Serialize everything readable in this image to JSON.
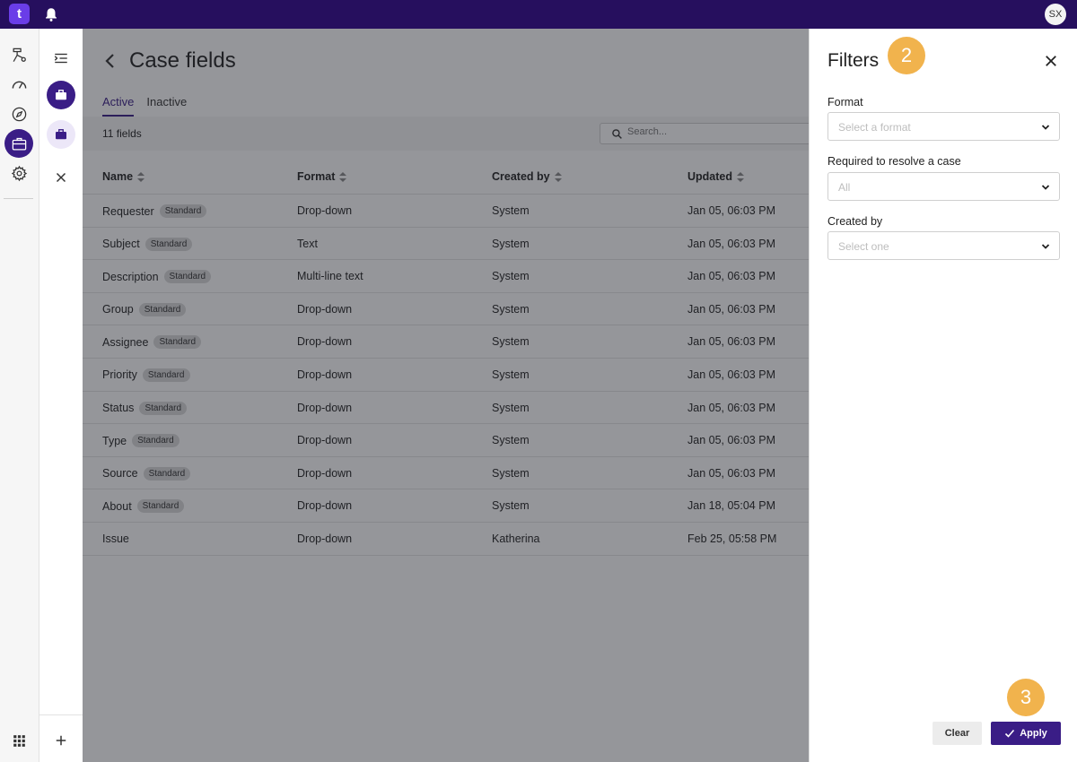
{
  "app": {
    "logo_text": "t",
    "avatar_initials": "SX"
  },
  "page": {
    "title": "Case fields",
    "tabs": [
      {
        "label": "Active",
        "active": true
      },
      {
        "label": "Inactive",
        "active": false
      }
    ],
    "count_label": "11 fields",
    "search_placeholder": "Search..."
  },
  "table": {
    "headers": [
      "Name",
      "Format",
      "Created by",
      "Updated"
    ],
    "rows": [
      {
        "name": "Requester",
        "badge": "Standard",
        "format": "Drop-down",
        "created_by": "System",
        "updated": "Jan 05, 06:03 PM"
      },
      {
        "name": "Subject",
        "badge": "Standard",
        "format": "Text",
        "created_by": "System",
        "updated": "Jan 05, 06:03 PM"
      },
      {
        "name": "Description",
        "badge": "Standard",
        "format": "Multi-line text",
        "created_by": "System",
        "updated": "Jan 05, 06:03 PM"
      },
      {
        "name": "Group",
        "badge": "Standard",
        "format": "Drop-down",
        "created_by": "System",
        "updated": "Jan 05, 06:03 PM"
      },
      {
        "name": "Assignee",
        "badge": "Standard",
        "format": "Drop-down",
        "created_by": "System",
        "updated": "Jan 05, 06:03 PM"
      },
      {
        "name": "Priority",
        "badge": "Standard",
        "format": "Drop-down",
        "created_by": "System",
        "updated": "Jan 05, 06:03 PM"
      },
      {
        "name": "Status",
        "badge": "Standard",
        "format": "Drop-down",
        "created_by": "System",
        "updated": "Jan 05, 06:03 PM"
      },
      {
        "name": "Type",
        "badge": "Standard",
        "format": "Drop-down",
        "created_by": "System",
        "updated": "Jan 05, 06:03 PM"
      },
      {
        "name": "Source",
        "badge": "Standard",
        "format": "Drop-down",
        "created_by": "System",
        "updated": "Jan 05, 06:03 PM"
      },
      {
        "name": "About",
        "badge": "Standard",
        "format": "Drop-down",
        "created_by": "System",
        "updated": "Jan 18, 05:04 PM"
      },
      {
        "name": "Issue",
        "badge": "",
        "format": "Drop-down",
        "created_by": "Katherina",
        "updated": "Feb 25, 05:58 PM"
      }
    ]
  },
  "filters": {
    "title": "Filters",
    "step_markers": [
      "2",
      "3"
    ],
    "fields": [
      {
        "label": "Format",
        "placeholder": "Select a format"
      },
      {
        "label": "Required to resolve a case",
        "placeholder": "All"
      },
      {
        "label": "Created by",
        "placeholder": "Select one"
      }
    ],
    "clear_label": "Clear",
    "apply_label": "Apply"
  },
  "icons": {
    "rail": [
      "workflow-icon",
      "dashboard-gauge-icon",
      "compass-icon",
      "briefcase-icon",
      "gear-icon",
      "apps-grid-icon"
    ],
    "subnav": [
      "collapse-menu-icon",
      "briefcase-icon",
      "close-icon",
      "plus-icon"
    ]
  },
  "colors": {
    "topbar": "#260f5e",
    "accent": "#3a1d86",
    "logo": "#6a3de8",
    "step_marker": "#f1b34d"
  }
}
